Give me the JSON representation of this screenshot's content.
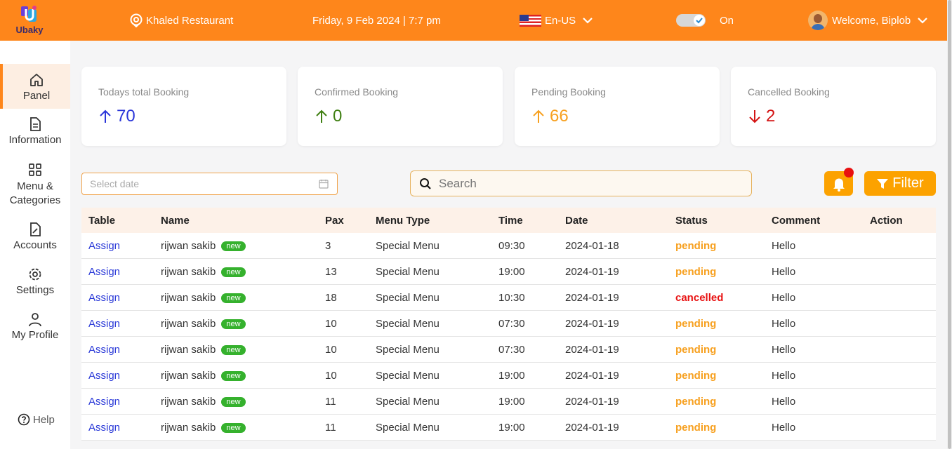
{
  "app": {
    "name": "Ubaky"
  },
  "topbar": {
    "restaurant": "Khaled Restaurant",
    "datetime": "Friday, 9 Feb 2024 | 7:7 pm",
    "language": "En-US",
    "toggle_label": "On",
    "welcome": "Welcome, Biplob"
  },
  "sidebar": {
    "items": [
      {
        "label": "Panel"
      },
      {
        "label": "Information"
      },
      {
        "label": "Menu & Categories"
      },
      {
        "label": "Accounts"
      },
      {
        "label": "Settings"
      },
      {
        "label": "My Profile"
      }
    ],
    "help": "Help"
  },
  "cards": [
    {
      "label": "Todays total Booking",
      "value": "70",
      "color": "#2b36d9"
    },
    {
      "label": "Confirmed Booking",
      "value": "0",
      "color": "#3f7f12"
    },
    {
      "label": "Pending Booking",
      "value": "66",
      "color": "#f7a01f"
    },
    {
      "label": "Cancelled Booking",
      "value": "2",
      "color": "#d41414"
    }
  ],
  "controls": {
    "date_placeholder": "Select date",
    "search_placeholder": "Search",
    "filter_label": "Filter"
  },
  "table": {
    "headers": [
      "Table",
      "Name",
      "Pax",
      "Menu Type",
      "Time",
      "Date",
      "Status",
      "Comment",
      "Action"
    ],
    "rows": [
      {
        "table": "Assign",
        "name": "rijwan sakib",
        "badge": "new",
        "pax": "3",
        "menu": "Special Menu",
        "time": "09:30",
        "date": "2024-01-18",
        "status": "pending",
        "comment": "Hello"
      },
      {
        "table": "Assign",
        "name": "rijwan sakib",
        "badge": "new",
        "pax": "13",
        "menu": "Special Menu",
        "time": "19:00",
        "date": "2024-01-19",
        "status": "pending",
        "comment": "Hello"
      },
      {
        "table": "Assign",
        "name": "rijwan sakib",
        "badge": "new",
        "pax": "18",
        "menu": "Special Menu",
        "time": "10:30",
        "date": "2024-01-19",
        "status": "cancelled",
        "comment": "Hello"
      },
      {
        "table": "Assign",
        "name": "rijwan sakib",
        "badge": "new",
        "pax": "10",
        "menu": "Special Menu",
        "time": "07:30",
        "date": "2024-01-19",
        "status": "pending",
        "comment": "Hello"
      },
      {
        "table": "Assign",
        "name": "rijwan sakib",
        "badge": "new",
        "pax": "10",
        "menu": "Special Menu",
        "time": "07:30",
        "date": "2024-01-19",
        "status": "pending",
        "comment": "Hello"
      },
      {
        "table": "Assign",
        "name": "rijwan sakib",
        "badge": "new",
        "pax": "10",
        "menu": "Special Menu",
        "time": "19:00",
        "date": "2024-01-19",
        "status": "pending",
        "comment": "Hello"
      },
      {
        "table": "Assign",
        "name": "rijwan sakib",
        "badge": "new",
        "pax": "11",
        "menu": "Special Menu",
        "time": "19:00",
        "date": "2024-01-19",
        "status": "pending",
        "comment": "Hello"
      },
      {
        "table": "Assign",
        "name": "rijwan sakib",
        "badge": "new",
        "pax": "11",
        "menu": "Special Menu",
        "time": "19:00",
        "date": "2024-01-19",
        "status": "pending",
        "comment": "Hello"
      }
    ]
  }
}
